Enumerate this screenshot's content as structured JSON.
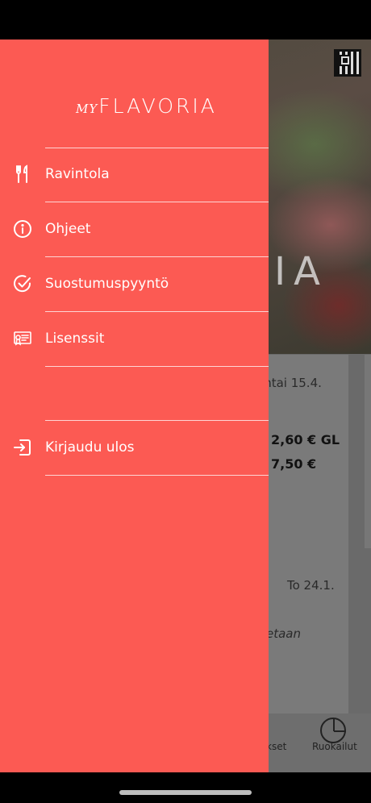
{
  "background": {
    "hero_text": "IA",
    "card1": {
      "date": "antai 15.4.",
      "price1": "2,60 € GL",
      "price2": "7,50 €"
    },
    "card2": {
      "date": "To 24.1.",
      "note": "etaan"
    },
    "bottom_nav": {
      "left_label": "kset",
      "right_label": "Ruokailut"
    }
  },
  "drawer": {
    "logo": {
      "prefix": "MY",
      "name": "FLAVORIA"
    },
    "menu": [
      {
        "label": "Ravintola",
        "icon": "fork-knife-icon"
      },
      {
        "label": "Ohjeet",
        "icon": "info-icon"
      },
      {
        "label": "Suostumuspyyntö",
        "icon": "check-circle-icon"
      },
      {
        "label": "Lisenssit",
        "icon": "certificate-icon"
      }
    ],
    "logout": {
      "label": "Kirjaudu ulos",
      "icon": "logout-icon"
    }
  },
  "colors": {
    "drawer_background": "#fc5a53",
    "drawer_text": "#ffffff"
  }
}
